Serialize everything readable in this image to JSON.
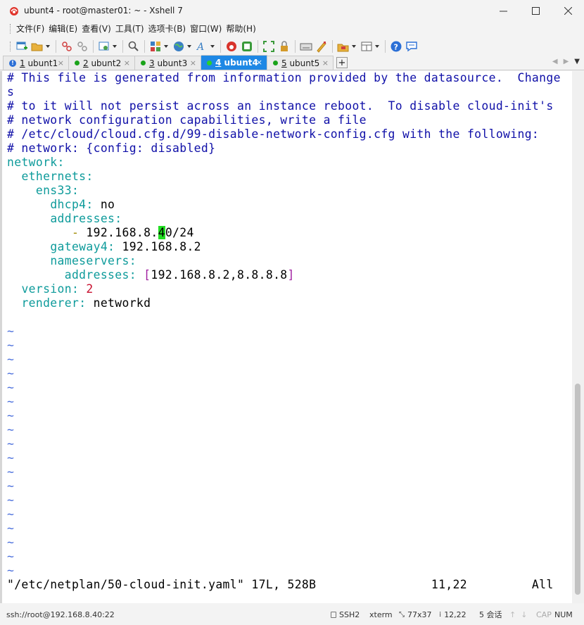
{
  "window": {
    "title": "ubunt4 - root@master01: ~ - Xshell 7",
    "colors": {
      "accent": "#1e88e5",
      "cursor": "#22dd22",
      "comment": "#1010a8",
      "key": "#0e9b9b"
    }
  },
  "menu": [
    {
      "label": "文件(F)"
    },
    {
      "label": "编辑(E)"
    },
    {
      "label": "查看(V)"
    },
    {
      "label": "工具(T)"
    },
    {
      "label": "选项卡(B)"
    },
    {
      "label": "窗口(W)"
    },
    {
      "label": "帮助(H)"
    }
  ],
  "toolbar_icons": [
    "new-session-icon",
    "open-folder-icon",
    "reconnect-icon",
    "disconnect-icon",
    "properties-icon",
    "find-icon",
    "layout-icon",
    "globe-icon",
    "font-icon",
    "xftp-icon",
    "xagent-icon",
    "fullscreen-icon",
    "lock-icon",
    "keyboard-icon",
    "highlight-icon",
    "compose-icon",
    "tab-layout-icon",
    "help-icon",
    "chat-icon"
  ],
  "tabs": [
    {
      "num": "1",
      "name": " ubunt1",
      "status": "info",
      "active": false
    },
    {
      "num": "2",
      "name": " ubunt2",
      "status": "connected",
      "active": false
    },
    {
      "num": "3",
      "name": " ubunt3",
      "status": "connected",
      "active": false
    },
    {
      "num": "4",
      "name": " ubunt4",
      "status": "connected",
      "active": true
    },
    {
      "num": "5",
      "name": " ubunt5",
      "status": "connected",
      "active": false
    }
  ],
  "terminal": {
    "lines": [
      {
        "type": "comment",
        "text": "# This file is generated from information provided by the datasource.  Change"
      },
      {
        "type": "comment",
        "text": "s"
      },
      {
        "type": "comment",
        "text": "# to it will not persist across an instance reboot.  To disable cloud-init's"
      },
      {
        "type": "comment",
        "text": "# network configuration capabilities, write a file"
      },
      {
        "type": "comment",
        "text": "# /etc/cloud/cloud.cfg.d/99-disable-network-config.cfg with the following:"
      },
      {
        "type": "comment",
        "text": "# network: {config: disabled}"
      },
      {
        "type": "kv",
        "indent": "",
        "key": "network",
        "sep": ":",
        "value": ""
      },
      {
        "type": "kv",
        "indent": "  ",
        "key": "ethernets",
        "sep": ":",
        "value": ""
      },
      {
        "type": "kv",
        "indent": "    ",
        "key": "ens33",
        "sep": ":",
        "value": ""
      },
      {
        "type": "kv",
        "indent": "      ",
        "key": "dhcp4",
        "sep": ":",
        "value": " no"
      },
      {
        "type": "kv",
        "indent": "      ",
        "key": "addresses",
        "sep": ":",
        "value": ""
      },
      {
        "type": "list",
        "indent": "         ",
        "dash": "-",
        "before": " 192.168.8.",
        "cursor": "4",
        "after": "0/24"
      },
      {
        "type": "kv",
        "indent": "      ",
        "key": "gateway4",
        "sep": ":",
        "value": " 192.168.8.2"
      },
      {
        "type": "kv",
        "indent": "      ",
        "key": "nameservers",
        "sep": ":",
        "value": ""
      },
      {
        "type": "array",
        "indent": "        ",
        "key": "addresses",
        "sep": ": ",
        "open": "[",
        "value": "192.168.8.2,8.8.8.8",
        "close": "]"
      },
      {
        "type": "num",
        "indent": "  ",
        "key": "version",
        "sep": ": ",
        "value": "2"
      },
      {
        "type": "kv",
        "indent": "  ",
        "key": "renderer",
        "sep": ":",
        "value": " networkd"
      },
      {
        "type": "blank",
        "text": ""
      },
      {
        "type": "tilde",
        "text": "~"
      },
      {
        "type": "tilde",
        "text": "~"
      },
      {
        "type": "tilde",
        "text": "~"
      },
      {
        "type": "tilde",
        "text": "~"
      },
      {
        "type": "tilde",
        "text": "~"
      },
      {
        "type": "tilde",
        "text": "~"
      },
      {
        "type": "tilde",
        "text": "~"
      },
      {
        "type": "tilde",
        "text": "~"
      },
      {
        "type": "tilde",
        "text": "~"
      },
      {
        "type": "tilde",
        "text": "~"
      },
      {
        "type": "tilde",
        "text": "~"
      },
      {
        "type": "tilde",
        "text": "~"
      },
      {
        "type": "tilde",
        "text": "~"
      },
      {
        "type": "tilde",
        "text": "~"
      },
      {
        "type": "tilde",
        "text": "~"
      },
      {
        "type": "tilde",
        "text": "~"
      },
      {
        "type": "tilde",
        "text": "~"
      },
      {
        "type": "tilde",
        "text": "~"
      },
      {
        "type": "status",
        "text": "\"/etc/netplan/50-cloud-init.yaml\" 17L, 528B                11,22         All"
      }
    ]
  },
  "statusbar": {
    "connection": "ssh://root@192.168.8.40:22",
    "protocol": "SSH2",
    "term": "xterm",
    "size": "77x37",
    "position": "12,22",
    "sessions": "5 会话",
    "caps": "CAP",
    "num": "NUM"
  }
}
